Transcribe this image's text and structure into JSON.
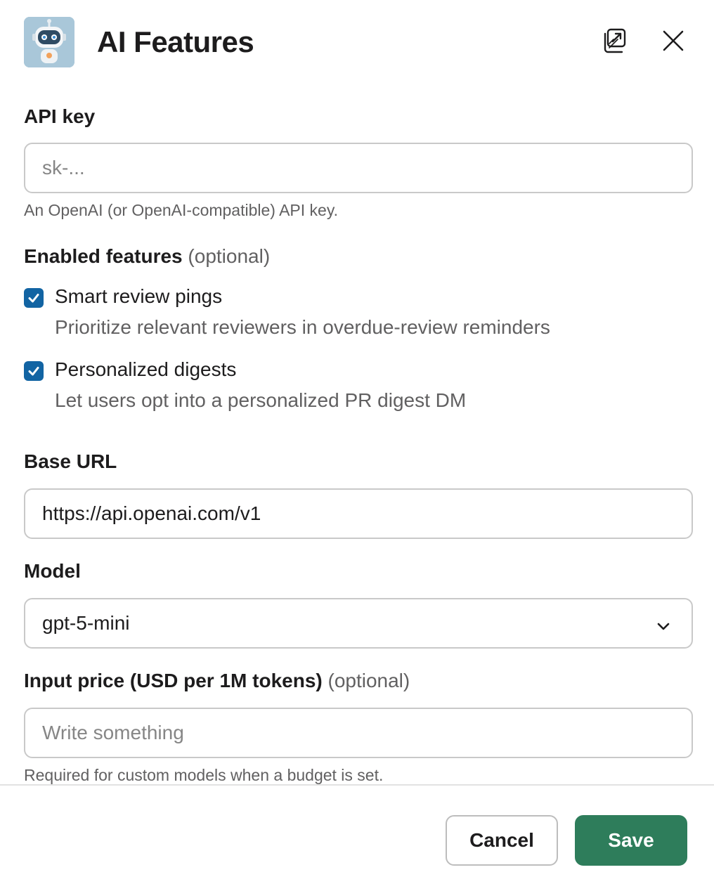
{
  "header": {
    "title": "AI Features",
    "app_icon": "robot-icon",
    "popout_icon": "popout-icon",
    "close_icon": "close-icon"
  },
  "api_key": {
    "label": "API key",
    "placeholder": "sk-...",
    "value": "",
    "hint": "An OpenAI (or OpenAI-compatible) API key."
  },
  "enabled_features": {
    "label": "Enabled features",
    "optional": "(optional)",
    "options": [
      {
        "title": "Smart review pings",
        "description": "Prioritize relevant reviewers in overdue-review reminders",
        "checked": true
      },
      {
        "title": "Personalized digests",
        "description": "Let users opt into a personalized PR digest DM",
        "checked": true
      }
    ]
  },
  "base_url": {
    "label": "Base URL",
    "value": "https://api.openai.com/v1"
  },
  "model": {
    "label": "Model",
    "selected": "gpt-5-mini"
  },
  "input_price": {
    "label": "Input price (USD per 1M tokens)",
    "optional": "(optional)",
    "placeholder": "Write something",
    "hint": "Required for custom models when a budget is set."
  },
  "footer": {
    "cancel_label": "Cancel",
    "save_label": "Save"
  },
  "colors": {
    "checkbox": "#1264a3",
    "save_button": "#2e7d5b"
  }
}
